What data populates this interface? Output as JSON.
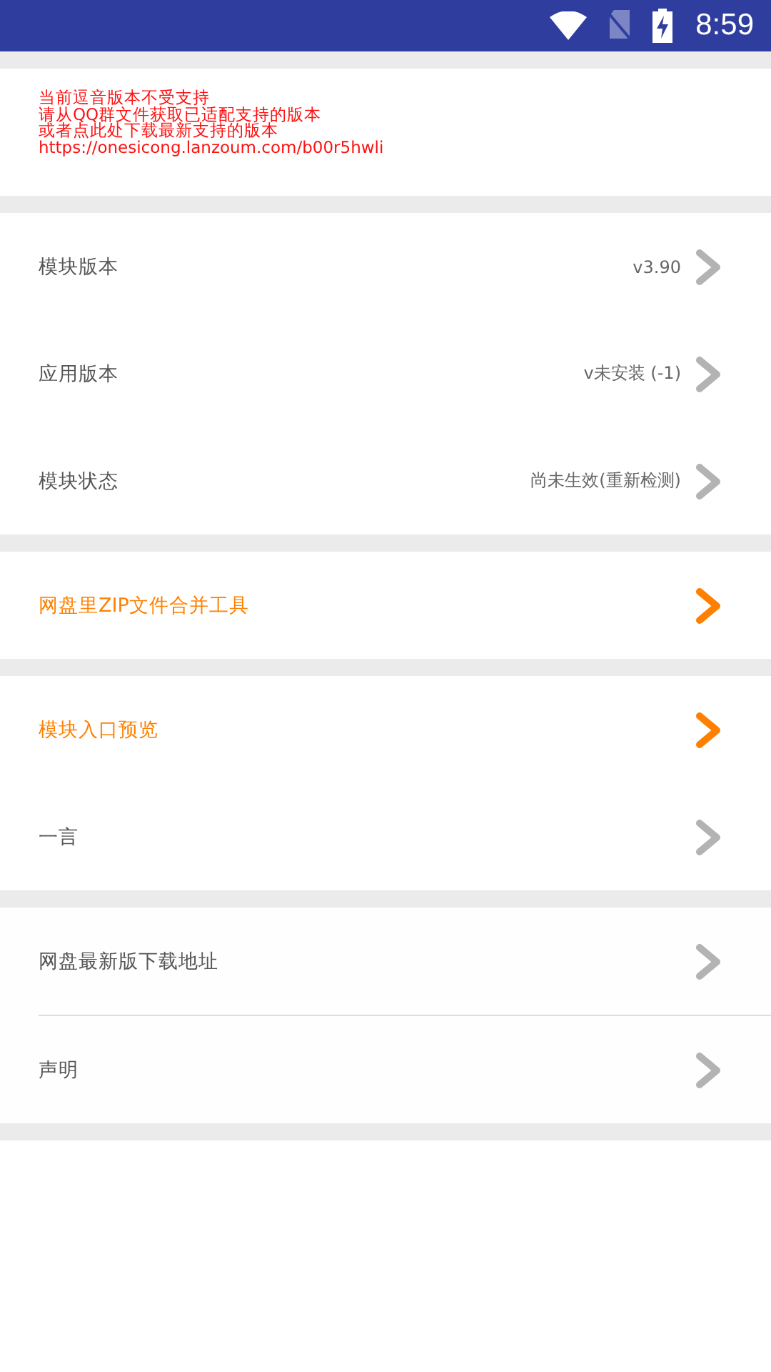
{
  "status_bar": {
    "time": "8:59"
  },
  "notice": {
    "lines": [
      "当前逗音版本不受支持",
      "请从QQ群文件获取已适配支持的版本",
      "或者点此处下载最新支持的版本",
      "https://onesicong.lanzoum.com/b00r5hwli"
    ]
  },
  "groups": [
    {
      "divided": false,
      "items": [
        {
          "label": "模块版本",
          "value": "v3.90",
          "highlighted": false
        },
        {
          "label": "应用版本",
          "value": "v未安装 (-1)",
          "highlighted": false
        },
        {
          "label": "模块状态",
          "value": "尚未生效(重新检测)",
          "highlighted": false
        }
      ]
    },
    {
      "divided": false,
      "items": [
        {
          "label": "网盘里ZIP文件合并工具",
          "highlighted": true
        }
      ]
    },
    {
      "divided": false,
      "items": [
        {
          "label": "模块入口预览",
          "highlighted": true
        },
        {
          "label": "一言",
          "highlighted": false
        }
      ]
    },
    {
      "divided": true,
      "items": [
        {
          "label": "网盘最新版下载地址",
          "highlighted": false
        },
        {
          "label": "声明",
          "highlighted": false
        }
      ]
    }
  ]
}
